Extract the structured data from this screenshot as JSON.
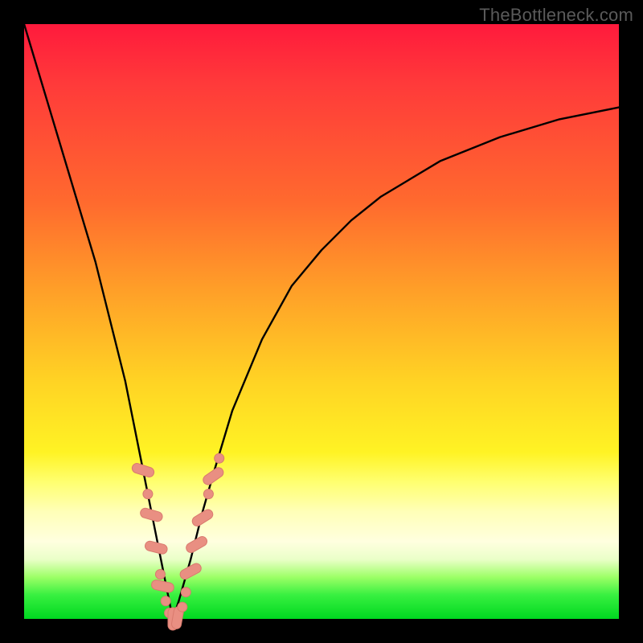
{
  "watermark": "TheBottleneck.com",
  "colors": {
    "frame": "#000000",
    "curve": "#000000",
    "marker_fill": "#e98f82",
    "marker_stroke": "#d97a6e",
    "gradient_top": "#ff1a3c",
    "gradient_mid": "#ffd324",
    "gradient_bottom": "#00d820"
  },
  "chart_data": {
    "type": "line",
    "title": "",
    "xlabel": "",
    "ylabel": "",
    "xlim": [
      0,
      100
    ],
    "ylim": [
      0,
      100
    ],
    "grid": false,
    "legend": false,
    "annotations": [
      "TheBottleneck.com"
    ],
    "series": [
      {
        "name": "bottleneck-curve",
        "x": [
          0,
          3,
          6,
          9,
          12,
          15,
          17,
          19,
          21,
          23,
          24,
          25,
          26,
          28,
          30,
          32,
          35,
          40,
          45,
          50,
          55,
          60,
          65,
          70,
          80,
          90,
          100
        ],
        "y": [
          100,
          90,
          80,
          70,
          60,
          48,
          40,
          30,
          20,
          10,
          5,
          0,
          3,
          10,
          18,
          25,
          35,
          47,
          56,
          62,
          67,
          71,
          74,
          77,
          81,
          84,
          86
        ]
      }
    ],
    "markers": [
      {
        "x": 20.0,
        "y": 25.0,
        "shape": "pill",
        "rotation": -72
      },
      {
        "x": 20.8,
        "y": 21.0,
        "shape": "dot"
      },
      {
        "x": 21.4,
        "y": 17.5,
        "shape": "pill",
        "rotation": -74
      },
      {
        "x": 22.2,
        "y": 12.0,
        "shape": "pill",
        "rotation": -76
      },
      {
        "x": 22.9,
        "y": 7.5,
        "shape": "dot"
      },
      {
        "x": 23.3,
        "y": 5.5,
        "shape": "pill",
        "rotation": -78
      },
      {
        "x": 23.8,
        "y": 3.0,
        "shape": "dot"
      },
      {
        "x": 24.4,
        "y": 1.0,
        "shape": "dot"
      },
      {
        "x": 25.0,
        "y": 0.0,
        "shape": "pill",
        "rotation": 0
      },
      {
        "x": 25.8,
        "y": 0.2,
        "shape": "pill",
        "rotation": 10
      },
      {
        "x": 26.6,
        "y": 2.0,
        "shape": "dot"
      },
      {
        "x": 27.2,
        "y": 4.5,
        "shape": "dot"
      },
      {
        "x": 28.0,
        "y": 8.0,
        "shape": "pill",
        "rotation": 62
      },
      {
        "x": 29.0,
        "y": 12.5,
        "shape": "pill",
        "rotation": 60
      },
      {
        "x": 30.0,
        "y": 17.0,
        "shape": "pill",
        "rotation": 58
      },
      {
        "x": 31.0,
        "y": 21.0,
        "shape": "dot"
      },
      {
        "x": 31.8,
        "y": 24.0,
        "shape": "pill",
        "rotation": 55
      },
      {
        "x": 32.8,
        "y": 27.0,
        "shape": "dot"
      }
    ]
  }
}
